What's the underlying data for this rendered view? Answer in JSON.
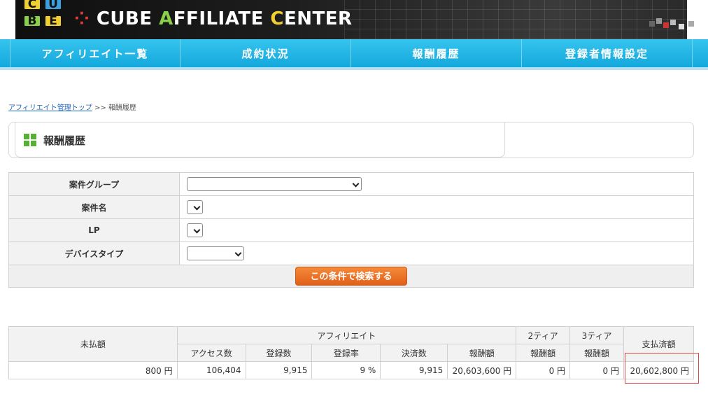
{
  "brand": {
    "logo_letters": [
      "C",
      "U",
      "B",
      "E"
    ],
    "title_prefix": "CUBE ",
    "title_a": "A",
    "title_mid": "FFILIATE ",
    "title_c": "C",
    "title_suffix": "ENTER"
  },
  "nav": {
    "items": [
      "アフィリエイト一覧",
      "成約状況",
      "報酬履歴",
      "登録者情報設定"
    ]
  },
  "breadcrumb": {
    "link": "アフィリエイト管理トップ",
    "separator": " >> ",
    "current": "報酬履歴"
  },
  "page_title": "報酬履歴",
  "search_form": {
    "rows": [
      {
        "label": "案件グループ",
        "value": ""
      },
      {
        "label": "案件名",
        "value": ""
      },
      {
        "label": "LP",
        "value": ""
      },
      {
        "label": "デバイスタイプ",
        "value": ""
      }
    ],
    "submit_label": "この条件で検索する"
  },
  "results": {
    "header_unpaid": "未払額",
    "header_affiliate": "アフィリエイト",
    "header_tier2_top": "2ティア",
    "header_tier2_bottom": "報酬額",
    "header_tier3_top": "3ティア",
    "header_tier3_bottom": "報酬額",
    "header_paid": "支払済額",
    "subheaders": [
      "アクセス数",
      "登録数",
      "登録率",
      "決済数",
      "報酬額"
    ],
    "row": {
      "unpaid": "800 円",
      "access": "106,404",
      "registrations": "9,915",
      "registration_rate": "9 %",
      "payments": "9,915",
      "reward": "20,603,600 円",
      "tier2_reward": "0 円",
      "tier3_reward": "0 円",
      "paid": "20,602,800 円"
    }
  },
  "colors": {
    "nav_bg": "#1fb3e4",
    "button_orange": "#e86a22",
    "title_icon_green": "#55b033",
    "highlight_red": "#e04848"
  }
}
